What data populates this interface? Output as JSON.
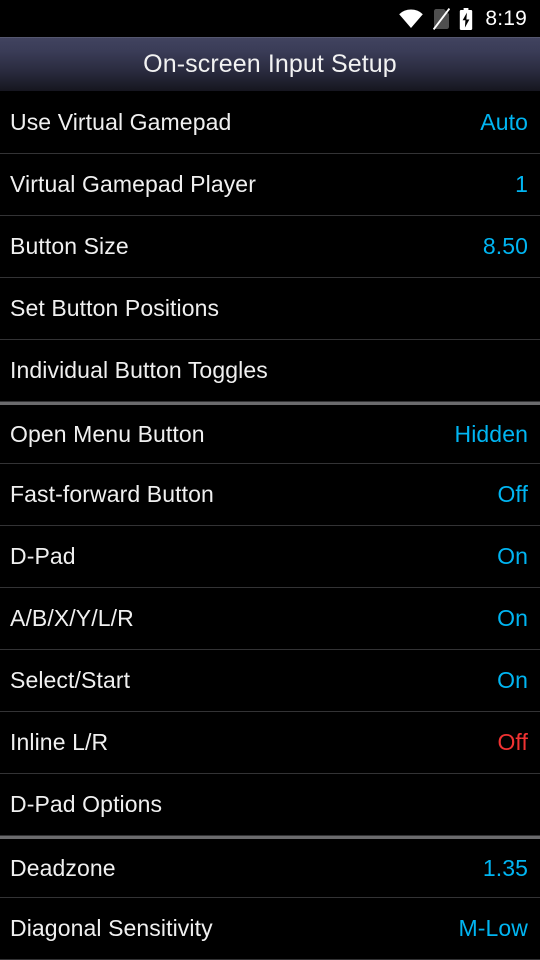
{
  "status_bar": {
    "icons": [
      {
        "name": "wifi-icon",
        "label": "wifi"
      },
      {
        "name": "no-sim-card-icon",
        "label": "no-sim"
      },
      {
        "name": "battery-charging-icon",
        "label": "battery-charging"
      }
    ],
    "time": "8:19"
  },
  "header": {
    "title": "On-screen Input Setup"
  },
  "colors": {
    "accent_value": "#00b5f2",
    "off_value": "#f03232",
    "title_text": "#f2f2f2",
    "row_title": "#f0f0f0",
    "background": "#000000",
    "row_divider": "#333335",
    "section_divider": "#6b6b6d",
    "titlebar_gradient_top": "#41435f",
    "titlebar_gradient_bottom": "#16161f"
  },
  "preferences": [
    {
      "name": "use-virtual-gamepad",
      "label": "Use Virtual Gamepad",
      "value": "Auto",
      "value_state": "accent",
      "section_start": false
    },
    {
      "name": "virtual-gamepad-player",
      "label": "Virtual Gamepad Player",
      "value": "1",
      "value_state": "accent",
      "section_start": false
    },
    {
      "name": "button-size",
      "label": "Button Size",
      "value": "8.50",
      "value_state": "accent",
      "section_start": false
    },
    {
      "name": "set-button-positions",
      "label": "Set Button Positions",
      "value": "",
      "value_state": "none",
      "section_start": false
    },
    {
      "name": "individual-button-toggles",
      "label": "Individual Button Toggles",
      "value": "",
      "value_state": "none",
      "section_start": false
    },
    {
      "name": "open-menu-button",
      "label": "Open Menu Button",
      "value": "Hidden",
      "value_state": "accent",
      "section_start": true
    },
    {
      "name": "fast-forward-button",
      "label": "Fast-forward Button",
      "value": "Off",
      "value_state": "accent",
      "section_start": false
    },
    {
      "name": "d-pad",
      "label": "D-Pad",
      "value": "On",
      "value_state": "accent",
      "section_start": false
    },
    {
      "name": "face-and-shoulder-buttons",
      "label": "A/B/X/Y/L/R",
      "value": "On",
      "value_state": "accent",
      "section_start": false
    },
    {
      "name": "select-start",
      "label": "Select/Start",
      "value": "On",
      "value_state": "accent",
      "section_start": false
    },
    {
      "name": "inline-l-r",
      "label": "Inline L/R",
      "value": "Off",
      "value_state": "off",
      "section_start": false
    },
    {
      "name": "d-pad-options",
      "label": "D-Pad Options",
      "value": "",
      "value_state": "none",
      "section_start": false
    },
    {
      "name": "deadzone",
      "label": "Deadzone",
      "value": "1.35",
      "value_state": "accent",
      "section_start": true
    },
    {
      "name": "diagonal-sensitivity",
      "label": "Diagonal Sensitivity",
      "value": "M-Low",
      "value_state": "accent",
      "section_start": false
    }
  ]
}
